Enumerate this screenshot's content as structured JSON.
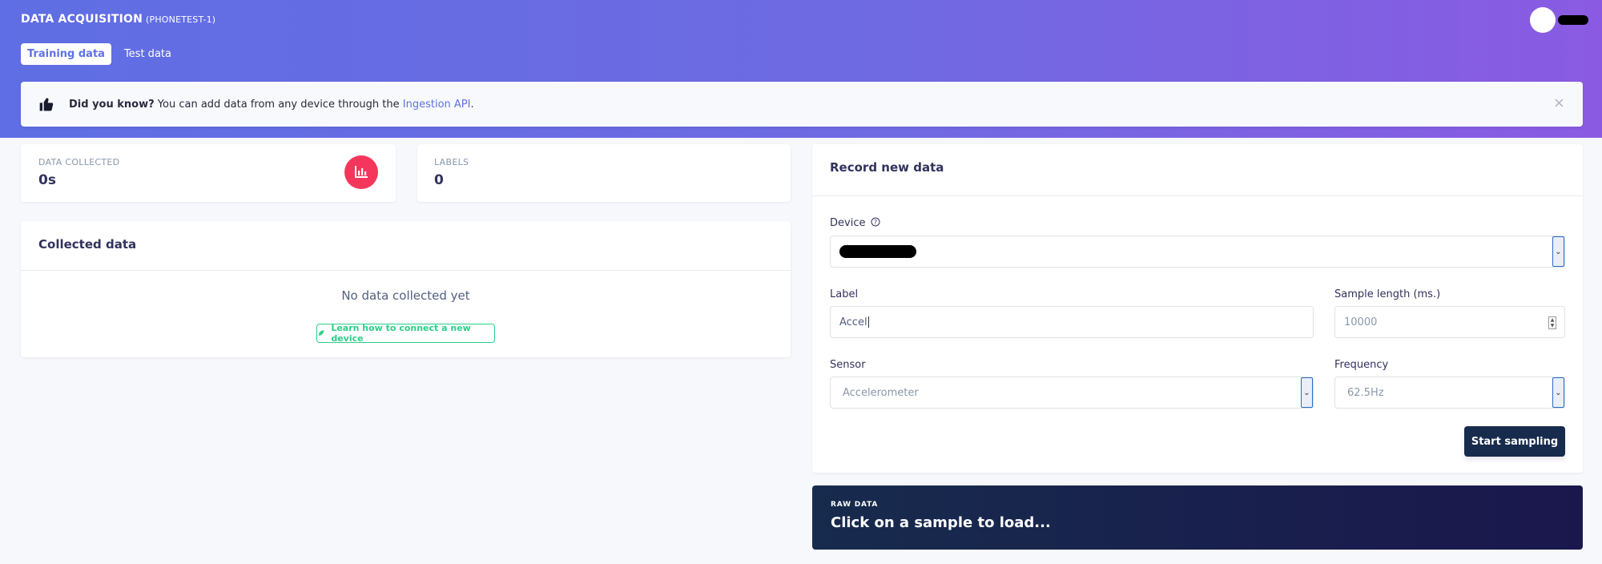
{
  "header": {
    "title": "DATA ACQUISITION",
    "project": "(PHONETEST-1)",
    "tabs": [
      {
        "label": "Training data",
        "active": true
      },
      {
        "label": "Test data",
        "active": false
      }
    ]
  },
  "tip": {
    "bold": "Did you know?",
    "text": " You can add data from any device through the ",
    "link": "Ingestion API",
    "suffix": ".",
    "close": "×"
  },
  "stats": {
    "data_collected": {
      "label": "DATA COLLECTED",
      "value": "0s"
    },
    "labels": {
      "label": "LABELS",
      "value": "0"
    }
  },
  "collected": {
    "title": "Collected data",
    "empty_message": "No data collected yet",
    "learn_button": "Learn how to connect a new device"
  },
  "record": {
    "title": "Record new data",
    "device_label": "Device",
    "label_label": "Label",
    "label_value": "Accel",
    "sample_length_label": "Sample length (ms.)",
    "sample_length_value": "10000",
    "sensor_label": "Sensor",
    "sensor_value": "Accelerometer",
    "frequency_label": "Frequency",
    "frequency_value": "62.5Hz",
    "start_button": "Start sampling"
  },
  "raw": {
    "label": "RAW DATA",
    "message": "Click on a sample to load..."
  },
  "colors": {
    "accent": "#5e72e4",
    "danger": "#f5365c",
    "success": "#2dce89",
    "dark": "#172b4d"
  }
}
